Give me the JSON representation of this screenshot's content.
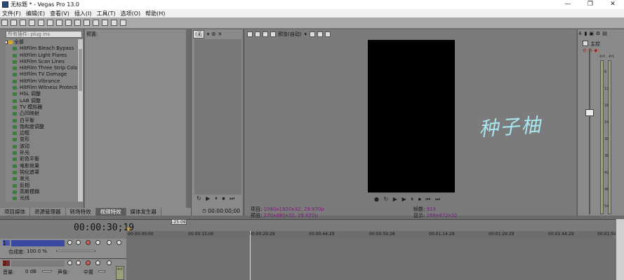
{
  "window": {
    "title": "无标题 * - Vegas Pro 13.0",
    "controls": [
      "—",
      "❐",
      "✕"
    ]
  },
  "menu": [
    "文件(F)",
    "编辑(E)",
    "查看(V)",
    "插入(I)",
    "工具(T)",
    "选项(O)",
    "帮助(H)"
  ],
  "effects": {
    "search_placeholder": "所有插件: plug ins",
    "root": "全部",
    "items": [
      "HitFilm Bleach Bypass",
      "HitFilm Light Flares",
      "HitFilm Scan Lines",
      "HitFilm Three Strip Colo",
      "HitFilm TV Damage",
      "HitFilm Vibrance",
      "HitFilm Witness Protecti",
      "HSL 调整",
      "LAB 调整",
      "TV 模拟器",
      "凸凹映射",
      "白平衡",
      "饱和度调整",
      "边框",
      "变形",
      "波动",
      "补光",
      "彩色平衡",
      "电影效果",
      "钝化遮罩",
      "发光",
      "反相",
      "高斯模糊",
      "光线"
    ]
  },
  "presets": {
    "label": "预置:"
  },
  "tabs": [
    "项目媒体",
    "资源管理器",
    "转场特效",
    "视频特效",
    "媒体发生器"
  ],
  "active_tab": "视频特效",
  "trimmer": {
    "dropdown": "(无",
    "timecode": "00:00:00;00"
  },
  "preview": {
    "quality": "预览(自动)",
    "project_label": "项目:",
    "project_value": "1080x1920x32, 29.970p",
    "preview_label": "预览:",
    "preview_value": "270x480x32, 29.970p",
    "frame_label": "帧数:",
    "frame_value": "919",
    "display_label": "显示:",
    "display_value": "266x472x32",
    "watermark": "种子柚"
  },
  "master": {
    "label": "主控",
    "badge": "4",
    "meter_labels": [
      "-Inf.",
      "-Inf."
    ],
    "scale": [
      "6",
      "12",
      "18",
      "24",
      "30",
      "36",
      "42",
      "48",
      "54"
    ]
  },
  "timeline": {
    "timecode": "00:00:30;19",
    "cursor_badge": "-25:09",
    "ticks": [
      "00:00:00;00",
      "00:00:15;00",
      "00:00:29;29",
      "00:00:44;29",
      "00:00:59;28",
      "00:01:14;29",
      "00:01:29;29",
      "00:01:44;29",
      "00:01:59;28"
    ],
    "video_track": {
      "number": "1",
      "level_label": "合成度:",
      "level_value": "100.0 %"
    },
    "audio_track": {
      "number": "2",
      "volume_label": "音量:",
      "volume_value": "0 dB",
      "pan_label": "声像:",
      "pan_value": "中置",
      "meter": "-Inf."
    }
  }
}
